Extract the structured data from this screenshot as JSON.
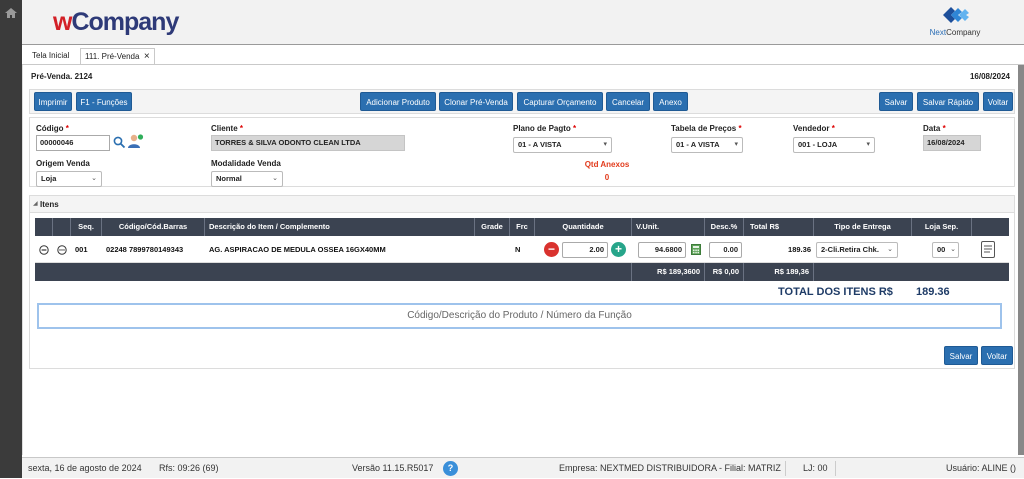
{
  "app": {
    "logo_w": "w",
    "logo_rest": "Company",
    "brand_right_a": "Next",
    "brand_right_b": "Company"
  },
  "tabs": [
    {
      "label": "Tela Inicial"
    },
    {
      "label": "111. Pré-Venda",
      "close": "×"
    }
  ],
  "page": {
    "title": "Pré-Venda. 2124",
    "date": "16/08/2024"
  },
  "toolbar": {
    "imprimir": "Imprimir",
    "funcoes": "F1 - Funções",
    "adicionar": "Adicionar Produto",
    "clonar": "Clonar Pré-Venda",
    "capturar": "Capturar Orçamento",
    "cancelar": "Cancelar",
    "anexo": "Anexo",
    "salvar": "Salvar",
    "salvar_rapido": "Salvar Rápido",
    "voltar": "Voltar"
  },
  "form": {
    "codigo": {
      "label": "Código",
      "value": "00000046"
    },
    "cliente": {
      "label": "Cliente",
      "value": "TORRES & SILVA ODONTO CLEAN LTDA"
    },
    "plano": {
      "label": "Plano de Pagto",
      "value": "01 - A VISTA"
    },
    "tabela": {
      "label": "Tabela de Preços",
      "value": "01 - A VISTA"
    },
    "vendedor": {
      "label": "Vendedor",
      "value": "001 - LOJA"
    },
    "data": {
      "label": "Data",
      "value": "16/08/2024"
    },
    "origem": {
      "label": "Origem Venda",
      "value": "Loja"
    },
    "modalidade": {
      "label": "Modalidade Venda",
      "value": "Normal"
    },
    "qtd_anexos": {
      "label": "Qtd Anexos",
      "value": "0"
    },
    "required_mark": "*"
  },
  "itens": {
    "title": "Itens",
    "headers": {
      "seq": "Seq.",
      "codigo": "Código/Cód.Barras",
      "descricao": "Descrição do Item / Complemento",
      "grade": "Grade",
      "frc": "Frc",
      "quantidade": "Quantidade",
      "vunit": "V.Unit.",
      "desc": "Desc.%",
      "total": "Total R$",
      "tipo": "Tipo de Entrega",
      "loja": "Loja Sep."
    },
    "row": {
      "seq": "001",
      "codigo": "02248 7899780149343",
      "descricao": "AG. ASPIRACAO DE MEDULA OSSEA 16GX40MM",
      "frc": "N",
      "quantidade": "2.00",
      "vunit": "94.6800",
      "desc": "0.00",
      "total": "189.36",
      "tipo": "2-Cli.Retira Chk.",
      "loja": "00"
    },
    "totals": {
      "vunit": "R$ 189,3600",
      "desc": "R$ 0,00",
      "total": "R$ 189,36"
    },
    "total_label": "TOTAL DOS ITENS R$",
    "total_value": "189.36",
    "search_placeholder": "Código/Descrição do Produto / Número da Função"
  },
  "bottom": {
    "salvar": "Salvar",
    "voltar": "Voltar"
  },
  "footer": {
    "date": "sexta, 16 de agosto de 2024",
    "rfs": "Rfs: 09:26 (69)",
    "version": "Versão 11.15.R5017",
    "help": "?",
    "empresa": "Empresa: NEXTMED DISTRIBUIDORA - Filial: MATRIZ",
    "lj": "LJ: 00",
    "usuario": "Usuário: ALINE ()"
  },
  "colors": {
    "primary": "#2b6fb0",
    "grid_header": "#3b4351",
    "minus": "#d9322e",
    "plus": "#27a58a",
    "alert": "#e23b1c"
  }
}
